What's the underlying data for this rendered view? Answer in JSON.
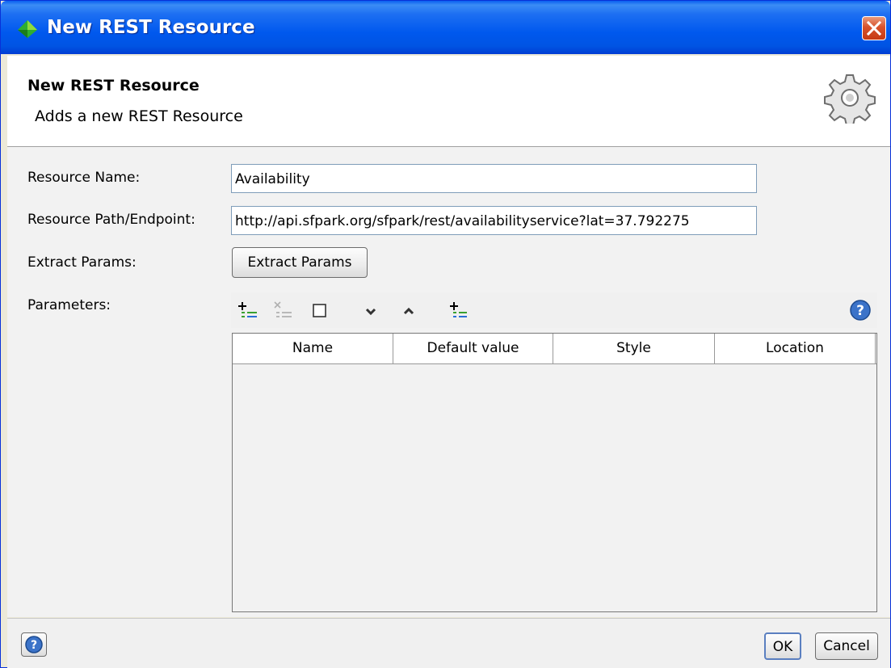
{
  "window": {
    "title": "New REST Resource",
    "title_bar_color": "#0054e3",
    "close_button_color": "#d8522b"
  },
  "header": {
    "title": "New REST Resource",
    "description": "Adds a new REST Resource",
    "icon": "gear-icon"
  },
  "form": {
    "resource_name_label": "Resource Name:",
    "resource_name_value": "Availability",
    "resource_path_label": "Resource Path/Endpoint:",
    "resource_path_value": "http://api.sfpark.org/sfpark/rest/availabilityservice?lat=37.792275",
    "extract_params_label": "Extract Params:",
    "extract_params_button": "Extract Params",
    "parameters_label": "Parameters:"
  },
  "toolbar": {
    "icons": [
      "add-param-icon",
      "remove-param-icon",
      "checkbox-icon",
      "move-down-icon",
      "move-up-icon",
      "add-params-icon",
      "help-icon"
    ]
  },
  "table": {
    "columns": [
      "Name",
      "Default value",
      "Style",
      "Location"
    ],
    "rows": []
  },
  "footer": {
    "ok_label": "OK",
    "cancel_label": "Cancel",
    "help_icon": "help-icon"
  }
}
